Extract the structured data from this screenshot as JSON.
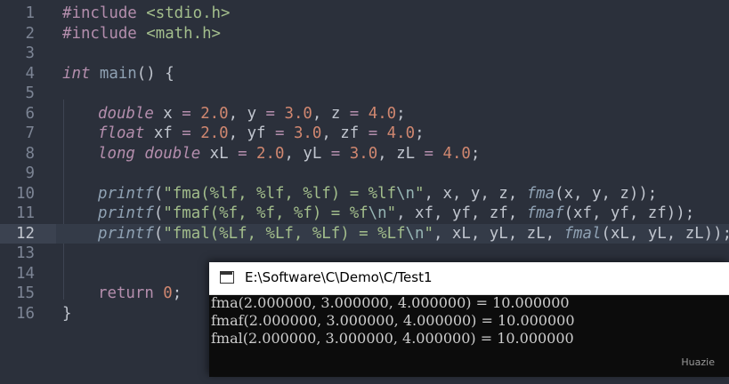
{
  "editor": {
    "line_numbers": [
      "1",
      "2",
      "3",
      "4",
      "5",
      "6",
      "7",
      "8",
      "9",
      "10",
      "11",
      "12",
      "13",
      "14",
      "15",
      "16"
    ],
    "active_line": "12",
    "lines": {
      "l1": {
        "a": "#include",
        "b": " ",
        "c": "<stdio.h>"
      },
      "l2": {
        "a": "#include",
        "b": " ",
        "c": "<math.h>"
      },
      "l4": {
        "kw": "int",
        "fn": " main",
        "rest": "() {"
      },
      "l6": {
        "t": "double",
        "v1": " x ",
        "eq": "=",
        "n1": " 2.0",
        "s1": ", y ",
        "n2": " 3.0",
        "s2": ", z ",
        "n3": " 4.0",
        "end": ";"
      },
      "l7": {
        "t": "float",
        "v1": " xf ",
        "eq": "=",
        "n1": " 2.0",
        "s1": ", yf ",
        "n2": " 3.0",
        "s2": ", zf ",
        "n3": " 4.0",
        "end": ";"
      },
      "l8": {
        "t": "long double",
        "v1": " xL ",
        "eq": "=",
        "n1": " 2.0",
        "s1": ", yL ",
        "n2": " 3.0",
        "s2": ", zL ",
        "n3": " 4.0",
        "end": ";"
      },
      "l10": {
        "fn": "printf",
        "open": "(",
        "str": "\"fma(%lf, %lf, %lf) = %lf",
        "esc": "\\n",
        "q": "\"",
        "args": ", x, y, z, ",
        "call": "fma",
        "tail": "(x, y, z));"
      },
      "l11": {
        "fn": "printf",
        "open": "(",
        "str": "\"fmaf(%f, %f, %f) = %f",
        "esc": "\\n",
        "q": "\"",
        "args": ", xf, yf, zf, ",
        "call": "fmaf",
        "tail": "(xf, yf, zf));"
      },
      "l12": {
        "fn": "printf",
        "open": "(",
        "str": "\"fmal(%Lf, %Lf, %Lf) = %Lf",
        "esc": "\\n",
        "q": "\"",
        "args": ", xL, yL, zL, ",
        "call": "fmal",
        "tail": "(xL, yL, zL));"
      },
      "l15": {
        "kw": "return",
        "num": " 0",
        "end": ";"
      },
      "l16": {
        "code": "}"
      }
    }
  },
  "console": {
    "title": "E:\\Software\\C\\Demo\\C/Test1",
    "output": [
      "fma(2.000000, 3.000000, 4.000000) = 10.000000",
      "fmaf(2.000000, 3.000000, 4.000000) = 10.000000",
      "fmal(2.000000, 3.000000, 4.000000) = 10.000000"
    ]
  },
  "watermark": "Huazie",
  "colors": {
    "background": "#2b303b",
    "keyword": "#b48ead",
    "string": "#a3be8c",
    "number": "#d08770",
    "function": "#8fa1b3"
  }
}
